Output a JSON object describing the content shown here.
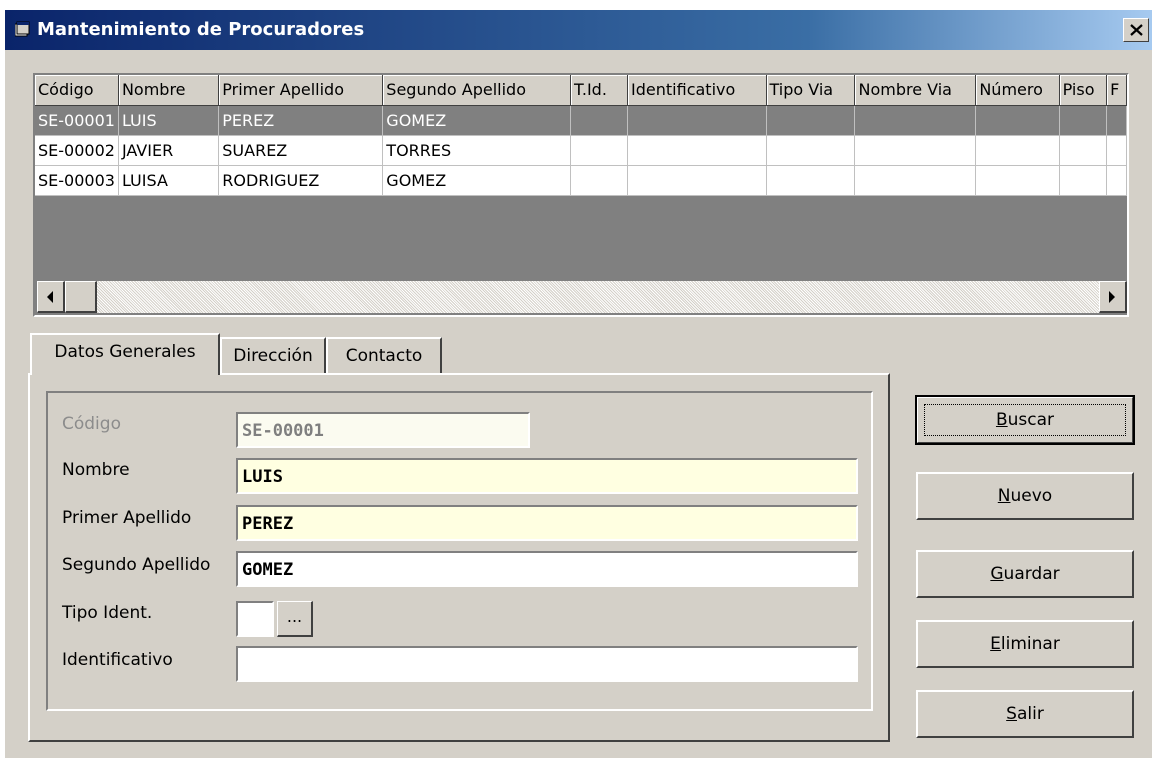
{
  "window": {
    "title": "Mantenimiento de Procuradores"
  },
  "grid": {
    "columns": [
      "Código",
      "Nombre",
      "Primer Apellido",
      "Segundo Apellido",
      "T.Id.",
      "Identificativo",
      "Tipo Via",
      "Nombre Via",
      "Número",
      "Piso",
      "F"
    ],
    "rows": [
      [
        "SE-00001",
        "LUIS",
        "PEREZ",
        "GOMEZ",
        "",
        "",
        "",
        "",
        "",
        "",
        ""
      ],
      [
        "SE-00002",
        "JAVIER",
        "SUAREZ",
        "TORRES",
        "",
        "",
        "",
        "",
        "",
        "",
        ""
      ],
      [
        "SE-00003",
        "LUISA",
        "RODRIGUEZ",
        "GOMEZ",
        "",
        "",
        "",
        "",
        "",
        "",
        ""
      ]
    ],
    "selected_row": 0
  },
  "tabs": [
    "Datos Generales",
    "Dirección",
    "Contacto"
  ],
  "active_tab": 0,
  "form": {
    "codigo_label": "Código",
    "codigo_value": "SE-00001",
    "nombre_label": "Nombre",
    "nombre_value": "LUIS",
    "primer_label": "Primer Apellido",
    "primer_value": "PEREZ",
    "segundo_label": "Segundo Apellido",
    "segundo_value": "GOMEZ",
    "tipo_label": "Tipo Ident.",
    "tipo_value": "",
    "tipo_button": "...",
    "ident_label": "Identificativo",
    "ident_value": ""
  },
  "buttons": {
    "buscar": {
      "mnemonic": "B",
      "rest": "uscar"
    },
    "nuevo": {
      "mnemonic": "N",
      "rest": "uevo"
    },
    "guardar": {
      "mnemonic": "G",
      "rest": "uardar"
    },
    "eliminar": {
      "mnemonic": "E",
      "rest": "liminar"
    },
    "salir": {
      "mnemonic": "S",
      "rest": "alir"
    }
  },
  "colors": {
    "title_start": "#0a246a",
    "title_end": "#a6caf0",
    "face": "#d4d0c8",
    "selected_row": "#808080",
    "field_bg": "#ffffe1"
  }
}
